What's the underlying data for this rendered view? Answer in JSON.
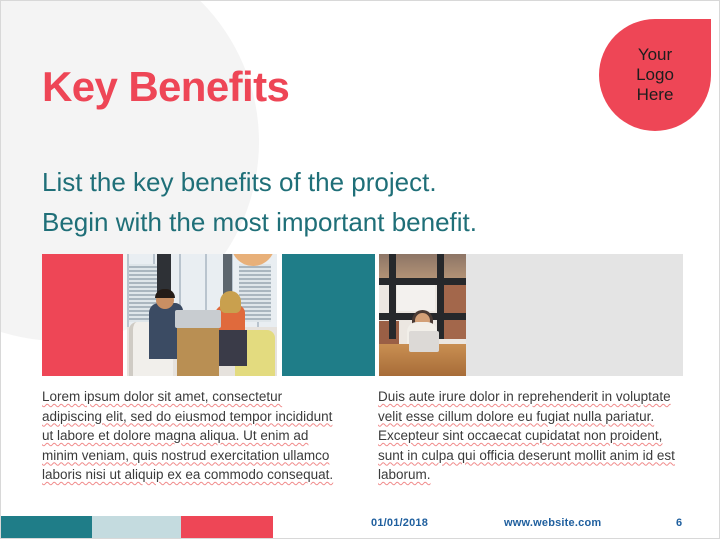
{
  "slide": {
    "title": "Key Benefits",
    "subtitle_lines": [
      "List the key benefits of the project.",
      "Begin with the most important benefit."
    ],
    "logo": {
      "line1": "Your",
      "line2": "Logo",
      "line3": "Here"
    },
    "body": {
      "left": "Lorem ipsum dolor sit amet, consectetur adipiscing elit, sed do eiusmod tempor incididunt ut labore et dolore magna aliqua. Ut enim ad minim veniam, quis nostrud exercitation ullamco laboris nisi ut aliquip ex ea commodo consequat.",
      "right": "Duis aute irure dolor in reprehenderit in voluptate velit esse cillum dolore eu fugiat nulla pariatur. Excepteur sint occaecat cupidatat non proident, sunt in culpa qui officia deserunt mollit anim id est laborum."
    },
    "strip": {
      "tiles": [
        {
          "name": "red-color-block",
          "kind": "color",
          "color": "#ee4656"
        },
        {
          "name": "photo-two-people-meeting",
          "kind": "photo"
        },
        {
          "name": "teal-color-block",
          "kind": "color",
          "color": "#1f7d88"
        },
        {
          "name": "photo-woman-laptop-loft",
          "kind": "photo"
        },
        {
          "name": "gray-image-placeholder",
          "kind": "placeholder",
          "color": "#e4e4e4"
        }
      ]
    },
    "footer": {
      "date": "01/01/2018",
      "website": "www.website.com",
      "page_number": "6",
      "bars": [
        {
          "name": "bar-teal",
          "color": "#1f7d88"
        },
        {
          "name": "bar-pale",
          "color": "#c4dbdf"
        },
        {
          "name": "bar-red",
          "color": "#ee4656"
        }
      ]
    },
    "colors": {
      "accent_red": "#ee4656",
      "accent_teal": "#1f6f78",
      "footer_blue": "#1f5f9e",
      "bg_circle": "#f4f4f4",
      "placeholder_gray": "#e4e4e4"
    }
  }
}
